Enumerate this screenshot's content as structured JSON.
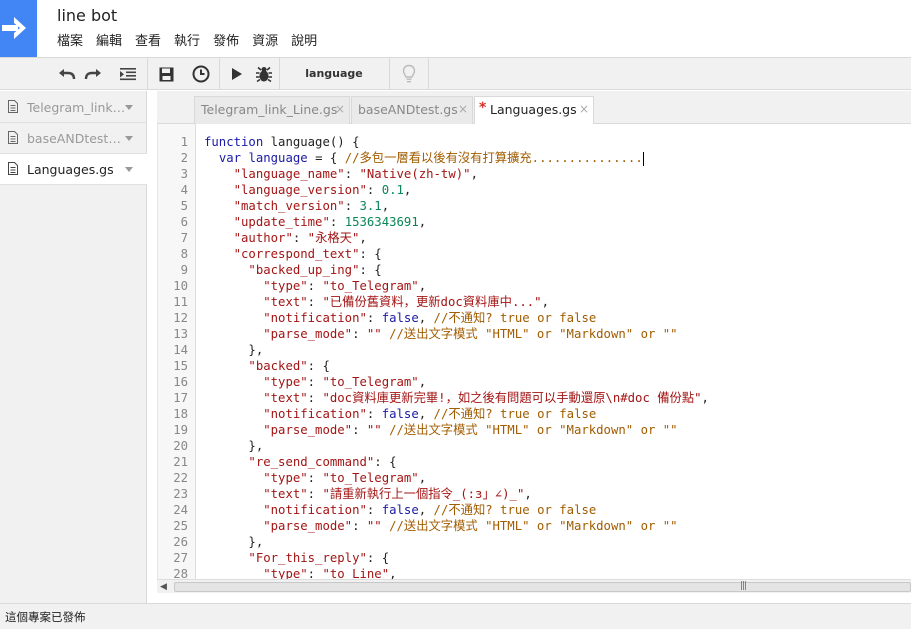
{
  "app": {
    "title": "line bot",
    "brand_color": "#4285f4"
  },
  "menu": [
    "檔案",
    "編輯",
    "查看",
    "執行",
    "發佈",
    "資源",
    "說明"
  ],
  "toolbar": {
    "buttons": [
      "undo-icon",
      "redo-icon",
      "indent-icon",
      "save-icon",
      "triggers-icon",
      "run-icon",
      "debug-icon",
      "lightbulb-icon"
    ],
    "function_select": "language"
  },
  "sidebar": {
    "files": [
      {
        "name": "Telegram_link…",
        "active": false
      },
      {
        "name": "baseANDtest…",
        "active": false
      },
      {
        "name": "Languages.gs",
        "active": true
      }
    ]
  },
  "tabs": [
    {
      "name": "Telegram_link_Line.gs",
      "close": "×",
      "active": false
    },
    {
      "name": "baseANDtest.gs",
      "close": "×",
      "active": false
    },
    {
      "name": "Languages.gs",
      "close": "×",
      "active": true,
      "unsaved_mark": "*"
    }
  ],
  "editor": {
    "lines": [
      {
        "n": "1",
        "t": [
          [
            "c-kw",
            "function "
          ],
          [
            "c-def",
            "language() {"
          ]
        ]
      },
      {
        "n": "2",
        "t": [
          [
            "c-def",
            "  "
          ],
          [
            "c-kw",
            "var "
          ],
          [
            "c-var",
            "language"
          ],
          [
            "c-def",
            " = { "
          ],
          [
            "c-com",
            "//多包一層看以後有沒有打算擴充..............."
          ]
        ]
      },
      {
        "n": "3",
        "t": [
          [
            "c-def",
            "    "
          ],
          [
            "c-str",
            "\"language_name\""
          ],
          [
            "c-def",
            ": "
          ],
          [
            "c-str",
            "\"Native(zh-tw)\""
          ],
          [
            "c-def",
            ","
          ]
        ]
      },
      {
        "n": "4",
        "t": [
          [
            "c-def",
            "    "
          ],
          [
            "c-str",
            "\"language_version\""
          ],
          [
            "c-def",
            ": "
          ],
          [
            "c-num",
            "0.1"
          ],
          [
            "c-def",
            ","
          ]
        ]
      },
      {
        "n": "5",
        "t": [
          [
            "c-def",
            "    "
          ],
          [
            "c-str",
            "\"match_version\""
          ],
          [
            "c-def",
            ": "
          ],
          [
            "c-num",
            "3.1"
          ],
          [
            "c-def",
            ","
          ]
        ]
      },
      {
        "n": "6",
        "t": [
          [
            "c-def",
            "    "
          ],
          [
            "c-str",
            "\"update_time\""
          ],
          [
            "c-def",
            ": "
          ],
          [
            "c-num",
            "1536343691"
          ],
          [
            "c-def",
            ","
          ]
        ]
      },
      {
        "n": "7",
        "t": [
          [
            "c-def",
            "    "
          ],
          [
            "c-str",
            "\"author\""
          ],
          [
            "c-def",
            ": "
          ],
          [
            "c-str",
            "\"永格天\""
          ],
          [
            "c-def",
            ","
          ]
        ]
      },
      {
        "n": "8",
        "t": [
          [
            "c-def",
            "    "
          ],
          [
            "c-str",
            "\"correspond_text\""
          ],
          [
            "c-def",
            ": {"
          ]
        ]
      },
      {
        "n": "9",
        "t": [
          [
            "c-def",
            "      "
          ],
          [
            "c-str",
            "\"backed_up_ing\""
          ],
          [
            "c-def",
            ": {"
          ]
        ]
      },
      {
        "n": "10",
        "t": [
          [
            "c-def",
            "        "
          ],
          [
            "c-str",
            "\"type\""
          ],
          [
            "c-def",
            ": "
          ],
          [
            "c-str",
            "\"to_Telegram\""
          ],
          [
            "c-def",
            ","
          ]
        ]
      },
      {
        "n": "11",
        "t": [
          [
            "c-def",
            "        "
          ],
          [
            "c-str",
            "\"text\""
          ],
          [
            "c-def",
            ": "
          ],
          [
            "c-str",
            "\"已備份舊資料，更新doc資料庫中...\""
          ],
          [
            "c-def",
            ","
          ]
        ]
      },
      {
        "n": "12",
        "t": [
          [
            "c-def",
            "        "
          ],
          [
            "c-str",
            "\"notification\""
          ],
          [
            "c-def",
            ": "
          ],
          [
            "c-kw",
            "false"
          ],
          [
            "c-def",
            ", "
          ],
          [
            "c-com",
            "//不通知? true or false"
          ]
        ]
      },
      {
        "n": "13",
        "t": [
          [
            "c-def",
            "        "
          ],
          [
            "c-str",
            "\"parse_mode\""
          ],
          [
            "c-def",
            ": "
          ],
          [
            "c-str",
            "\"\""
          ],
          [
            "c-def",
            " "
          ],
          [
            "c-com",
            "//送出文字模式 \"HTML\" or \"Markdown\" or \"\""
          ]
        ]
      },
      {
        "n": "14",
        "t": [
          [
            "c-def",
            "      },"
          ]
        ]
      },
      {
        "n": "15",
        "t": [
          [
            "c-def",
            "      "
          ],
          [
            "c-str",
            "\"backed\""
          ],
          [
            "c-def",
            ": {"
          ]
        ]
      },
      {
        "n": "16",
        "t": [
          [
            "c-def",
            "        "
          ],
          [
            "c-str",
            "\"type\""
          ],
          [
            "c-def",
            ": "
          ],
          [
            "c-str",
            "\"to_Telegram\""
          ],
          [
            "c-def",
            ","
          ]
        ]
      },
      {
        "n": "17",
        "t": [
          [
            "c-def",
            "        "
          ],
          [
            "c-str",
            "\"text\""
          ],
          [
            "c-def",
            ": "
          ],
          [
            "c-str",
            "\"doc資料庫更新完畢!，如之後有問題可以手動還原\\n#doc 備份點\""
          ],
          [
            "c-def",
            ","
          ]
        ]
      },
      {
        "n": "18",
        "t": [
          [
            "c-def",
            "        "
          ],
          [
            "c-str",
            "\"notification\""
          ],
          [
            "c-def",
            ": "
          ],
          [
            "c-kw",
            "false"
          ],
          [
            "c-def",
            ", "
          ],
          [
            "c-com",
            "//不通知? true or false"
          ]
        ]
      },
      {
        "n": "19",
        "t": [
          [
            "c-def",
            "        "
          ],
          [
            "c-str",
            "\"parse_mode\""
          ],
          [
            "c-def",
            ": "
          ],
          [
            "c-str",
            "\"\""
          ],
          [
            "c-def",
            " "
          ],
          [
            "c-com",
            "//送出文字模式 \"HTML\" or \"Markdown\" or \"\""
          ]
        ]
      },
      {
        "n": "20",
        "t": [
          [
            "c-def",
            "      },"
          ]
        ]
      },
      {
        "n": "21",
        "t": [
          [
            "c-def",
            "      "
          ],
          [
            "c-str",
            "\"re_send_command\""
          ],
          [
            "c-def",
            ": {"
          ]
        ]
      },
      {
        "n": "22",
        "t": [
          [
            "c-def",
            "        "
          ],
          [
            "c-str",
            "\"type\""
          ],
          [
            "c-def",
            ": "
          ],
          [
            "c-str",
            "\"to_Telegram\""
          ],
          [
            "c-def",
            ","
          ]
        ]
      },
      {
        "n": "23",
        "t": [
          [
            "c-def",
            "        "
          ],
          [
            "c-str",
            "\"text\""
          ],
          [
            "c-def",
            ": "
          ],
          [
            "c-str",
            "\"請重新執行上一個指令_(:з」∠)_\""
          ],
          [
            "c-def",
            ","
          ]
        ]
      },
      {
        "n": "24",
        "t": [
          [
            "c-def",
            "        "
          ],
          [
            "c-str",
            "\"notification\""
          ],
          [
            "c-def",
            ": "
          ],
          [
            "c-kw",
            "false"
          ],
          [
            "c-def",
            ", "
          ],
          [
            "c-com",
            "//不通知? true or false"
          ]
        ]
      },
      {
        "n": "25",
        "t": [
          [
            "c-def",
            "        "
          ],
          [
            "c-str",
            "\"parse_mode\""
          ],
          [
            "c-def",
            ": "
          ],
          [
            "c-str",
            "\"\""
          ],
          [
            "c-def",
            " "
          ],
          [
            "c-com",
            "//送出文字模式 \"HTML\" or \"Markdown\" or \"\""
          ]
        ]
      },
      {
        "n": "26",
        "t": [
          [
            "c-def",
            "      },"
          ]
        ]
      },
      {
        "n": "27",
        "t": [
          [
            "c-def",
            "      "
          ],
          [
            "c-str",
            "\"For_this_reply\""
          ],
          [
            "c-def",
            ": {"
          ]
        ]
      },
      {
        "n": "28",
        "t": [
          [
            "c-def",
            "        "
          ],
          [
            "c-str",
            "\"type\""
          ],
          [
            "c-def",
            ": "
          ],
          [
            "c-str",
            "\"to_Line\""
          ],
          [
            "c-def",
            ","
          ]
        ]
      }
    ],
    "cursor_line": "2"
  },
  "status": {
    "text": "這個專案已發佈"
  }
}
